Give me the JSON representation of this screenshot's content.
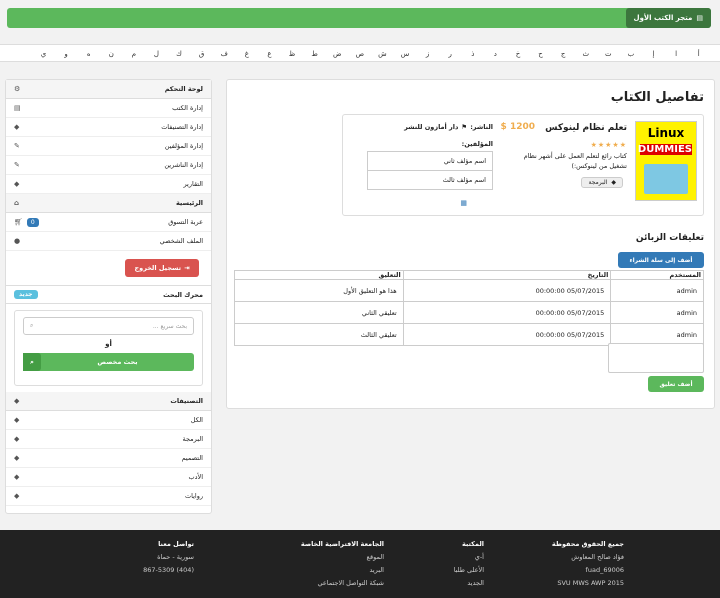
{
  "brand": {
    "title": "متجر الكتب الأول",
    "icon": "book-icon"
  },
  "alphabet": [
    "أ",
    "ا",
    "إ",
    "ب",
    "ت",
    "ث",
    "ج",
    "ح",
    "خ",
    "د",
    "ذ",
    "ر",
    "ز",
    "س",
    "ش",
    "ص",
    "ض",
    "ط",
    "ظ",
    "ع",
    "غ",
    "ف",
    "ق",
    "ك",
    "ل",
    "م",
    "ن",
    "ه",
    "و",
    "ي"
  ],
  "sidebar": {
    "control_panel": "لوحة التحكم",
    "admin_items": [
      {
        "label": "إدارة الكتب",
        "icon": "book-icon"
      },
      {
        "label": "إدارة التصنيفات",
        "icon": "tags-icon"
      },
      {
        "label": "إدارة المؤلفين",
        "icon": "edit-icon"
      },
      {
        "label": "إدارة الناشرين",
        "icon": "edit-icon"
      },
      {
        "label": "التقارير",
        "icon": "tags-icon"
      }
    ],
    "home_header": "الرئيسية",
    "home_items": [
      {
        "label": "عربة التسوق",
        "badge": "0",
        "icon": "cart-icon"
      },
      {
        "label": "الملف الشخصي",
        "icon": "user-icon"
      }
    ],
    "logout": "تسجيل الخروج",
    "search_header": "محرك البحث",
    "search_badge": "جديد",
    "search_placeholder": "بحث سريع ...",
    "or_label": "أو",
    "advanced_search": "بحث مخصص",
    "categories_header": "التصنيفات",
    "categories": [
      "الكل",
      "البرمجة",
      "التصميم",
      "الأدب",
      "روايات"
    ]
  },
  "main": {
    "page_title": "تفاصيل الكتاب",
    "book": {
      "title": "تعلم نظام لينوكس",
      "price": "1200 $",
      "rating_stars": 5,
      "description": "كتاب رائع لتعلم العمل على أشهر نظام تشغيل من لينوكس:)",
      "category": "البرمجة",
      "publisher_label": "الناشر:",
      "publisher": "دار أمازون للنشر",
      "authors_label": "المؤلفين:",
      "authors": [
        "اسم مؤلف ثاني",
        "اسم مؤلف ثالث"
      ],
      "cover": {
        "line1": "Linux",
        "line2": "DUMMIES"
      }
    },
    "comments_title": "تعليقات الزبائن",
    "add_to_cart": "أضف إلى سلة الشراء",
    "comment_headers": [
      "المستخدم",
      "التاريخ",
      "التعليق"
    ],
    "comments": [
      {
        "user": "admin",
        "date": "05/07/2015 00:00:00",
        "text": "هذا هو التعليق الأول"
      },
      {
        "user": "admin",
        "date": "05/07/2015 00:00:00",
        "text": "تعليقي الثاني"
      },
      {
        "user": "admin",
        "date": "05/07/2015 00:00:00",
        "text": "تعليقي الثالث"
      }
    ],
    "add_comment": "أضف تعليق"
  },
  "footer": {
    "col1": {
      "title": "جميع الحقوق محفوظة",
      "lines": [
        "فؤاد صالح المعاوش",
        "fuad_69006",
        "SVU MWS AWP 2015"
      ]
    },
    "col2": {
      "title": "المكتبة",
      "lines": [
        "أ-ي",
        "الأعلى طلبا",
        "الجديد"
      ]
    },
    "col3": {
      "title": "الجامعة الافتراضية الخاصة",
      "lines": [
        "الموقع",
        "البريد",
        "شبكة التواصل الاجتماعي"
      ]
    },
    "col4": {
      "title": "تواصل معنا",
      "lines": [
        "سورية - حماة",
        "(404) 867-5309"
      ]
    }
  }
}
